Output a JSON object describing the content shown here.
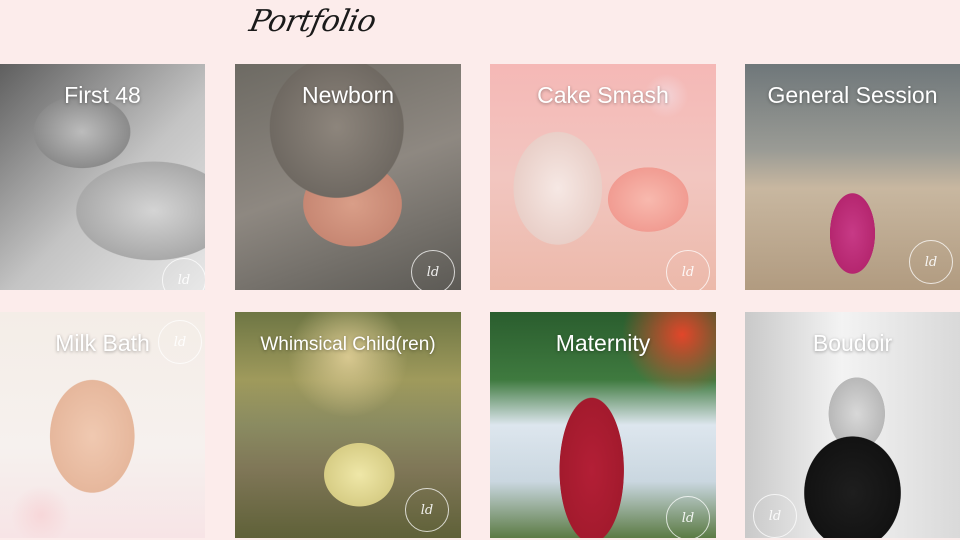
{
  "page": {
    "title": "Portfolio",
    "watermark": "ld"
  },
  "tiles": [
    {
      "label": "First 48"
    },
    {
      "label": "Newborn"
    },
    {
      "label": "Cake Smash"
    },
    {
      "label": "General Session"
    },
    {
      "label": "Milk Bath"
    },
    {
      "label": "Whimsical Child(ren)"
    },
    {
      "label": "Maternity"
    },
    {
      "label": "Boudoir"
    }
  ]
}
